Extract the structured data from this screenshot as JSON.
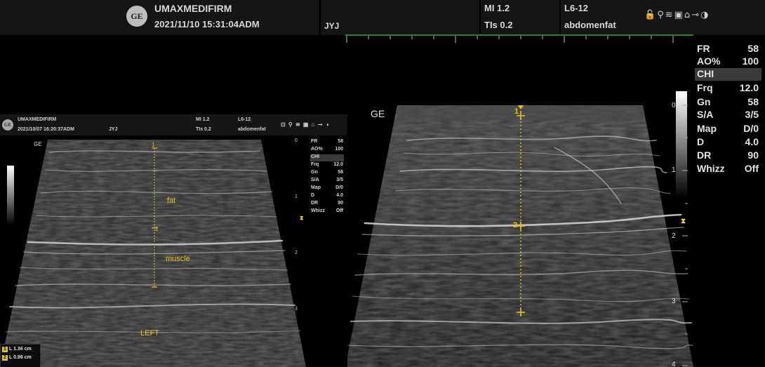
{
  "header": {
    "site": "UMAXMEDIFIRM",
    "datetime": "2021/11/10 15:31:04ADM",
    "operator": "JYJ",
    "mi": "MI 1.2",
    "tis": "TIs 0.2",
    "probe": "L6-12",
    "preset": "abdomenfat",
    "logo_text": "GE",
    "icons": [
      "lock-icon",
      "probe-icon",
      "network-icon",
      "disk-icon",
      "printer-icon",
      "key-icon",
      "contrast-icon"
    ]
  },
  "params": [
    {
      "key": "FR",
      "value": "58"
    },
    {
      "key": "AO%",
      "value": "100"
    },
    {
      "key": "CHI",
      "value": ""
    },
    {
      "key": "Frq",
      "value": "12.0"
    },
    {
      "key": "Gn",
      "value": "58"
    },
    {
      "key": "S/A",
      "value": "3/5"
    },
    {
      "key": "Map",
      "value": "D/0"
    },
    {
      "key": "D",
      "value": "4.0"
    },
    {
      "key": "DR",
      "value": "90"
    },
    {
      "key": "Whizz",
      "value": "Off"
    }
  ],
  "image_label": "GE",
  "depth_scale": [
    "0",
    "1",
    "2",
    "3",
    "4"
  ],
  "markers": {
    "start": "1",
    "end": "2"
  },
  "colors": {
    "caliper": "#e6c21e",
    "focus": "#e8d24a",
    "header_bg": "#151515"
  },
  "inset": {
    "header": {
      "site": "UMAXMEDIFIRM",
      "datetime": "2021/10/07 16:20:37ADM",
      "operator": "JYJ",
      "mi": "MI 1.2",
      "tis": "TIs 0.2",
      "probe": "L6-12",
      "preset": "abdomenfat"
    },
    "params": [
      {
        "key": "FR",
        "value": "58"
      },
      {
        "key": "AO%",
        "value": "100"
      },
      {
        "key": "CHI",
        "value": ""
      },
      {
        "key": "Frq",
        "value": "12.0"
      },
      {
        "key": "Gn",
        "value": "58"
      },
      {
        "key": "S/A",
        "value": "3/5"
      },
      {
        "key": "Map",
        "value": "D/0"
      },
      {
        "key": "D",
        "value": "4.0"
      },
      {
        "key": "DR",
        "value": "90"
      },
      {
        "key": "Whizz",
        "value": "Off"
      }
    ],
    "image_label": "GE",
    "depth_scale": [
      "0",
      "1",
      "2",
      "3"
    ],
    "annotations": {
      "fat": "fat",
      "muscle": "muscle",
      "side": "LEFT"
    },
    "markers": {
      "start": "1",
      "end": "2"
    },
    "measurements": [
      {
        "id": "1",
        "text": "L 1.36 cm"
      },
      {
        "id": "2",
        "text": "L 0.96 cm"
      }
    ]
  }
}
